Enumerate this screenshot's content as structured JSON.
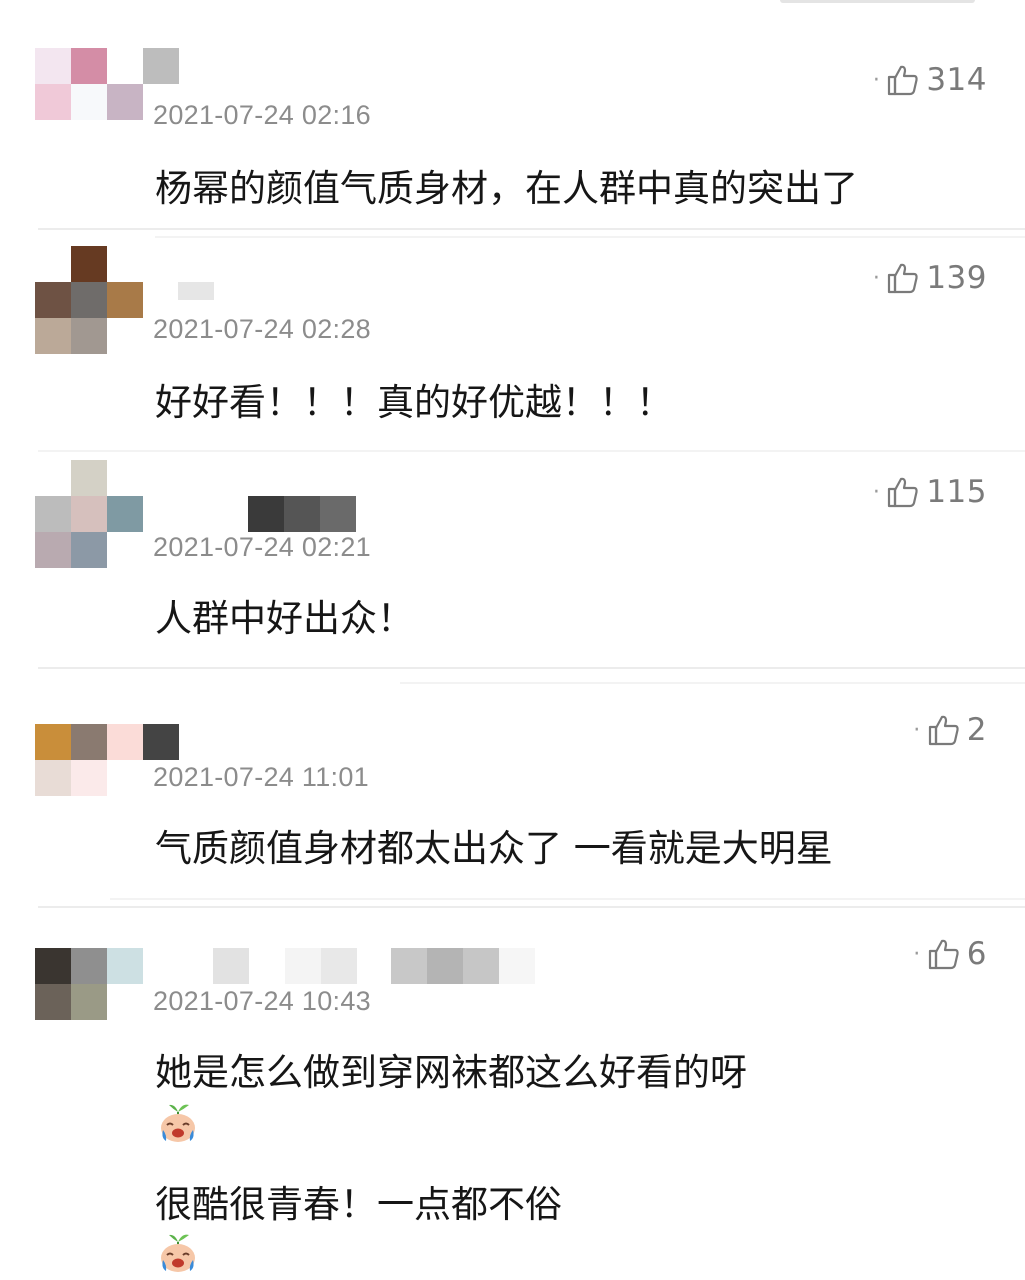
{
  "comments": [
    {
      "likes": "314",
      "timestamp": "2021-07-24 02:16",
      "lines": [
        "杨幂的颜值气质身材，在人群中真的突出了"
      ]
    },
    {
      "likes": "139",
      "timestamp": "2021-07-24 02:28",
      "lines": [
        "好好看！！！真的好优越！！！"
      ]
    },
    {
      "likes": "115",
      "timestamp": "2021-07-24 02:21",
      "lines": [
        "人群中好出众！"
      ]
    },
    {
      "likes": "2",
      "timestamp": "2021-07-24 11:01",
      "lines": [
        "气质颜值身材都太出众了 一看就是大明星"
      ]
    },
    {
      "likes": "6",
      "timestamp": "2021-07-24 10:43",
      "lines": [
        "她是怎么做到穿网袜都这么好看的呀",
        "很酷很青春！一点都不俗"
      ]
    }
  ],
  "icons": {
    "like": "thumbs-up-icon",
    "emoji": "crying-sprout-emoji-icon"
  },
  "colors": {
    "timestamp": "#8c8c8c",
    "like_text": "#7a7a7a",
    "divider": "#ececec"
  }
}
